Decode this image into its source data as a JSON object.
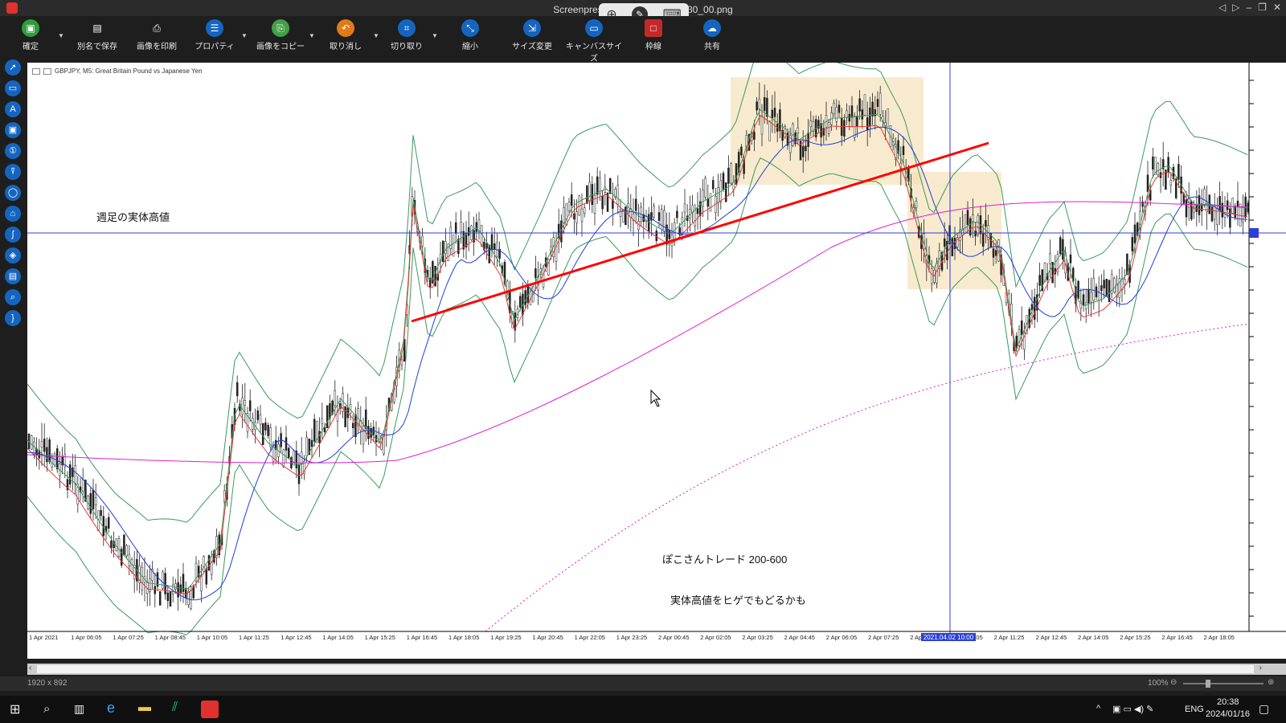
{
  "window": {
    "title": "Screenpressoの画像 ... 16_20h30_00.png"
  },
  "toolbar": {
    "confirm": "確定",
    "save_as": "別名で保存",
    "print": "画像を印刷",
    "properties": "プロパティ",
    "copy": "画像をコピー",
    "undo": "取り消し",
    "crop": "切り取り",
    "shrink": "縮小",
    "resize": "サイズ変更",
    "canvas": "キャンバスサイズ",
    "border": "枠線",
    "share": "共有"
  },
  "chart": {
    "header": "GBPJPY, M5: Great Britain Pound vs Japanese Yen",
    "time_labels": [
      "1 Apr 2021",
      "1 Apr 06:05",
      "1 Apr 07:25",
      "1 Apr 08:45",
      "1 Apr 10:05",
      "1 Apr 11:25",
      "1 Apr 12:45",
      "1 Apr 14:05",
      "1 Apr 15:25",
      "1 Apr 16:45",
      "1 Apr 18:05",
      "1 Apr 19:25",
      "1 Apr 20:45",
      "1 Apr 22:05",
      "1 Apr 23:25",
      "2 Apr 00:45",
      "2 Apr 02:05",
      "2 Apr 03:25",
      "2 Apr 04:45",
      "2 Apr 06:05",
      "2 Apr 07:25",
      "2 Apr 08:45",
      "2 Apr 10:05",
      "2 Apr 11:25",
      "2 Apr 12:45",
      "2 Apr 14:05",
      "2 Apr 15:25",
      "2 Apr 16:45",
      "2 Apr 18:05"
    ],
    "crosshair_label": "2021.04.02 10:00",
    "annotation_weekly_high": "週足の実体高値",
    "annotation_trade": "ぽこさんトレード  200-600",
    "annotation_note": "実体高値をヒゲでもどるかも"
  },
  "statusbar": {
    "image_size": "1920 x 892",
    "zoom": "100%"
  },
  "taskbar": {
    "lang": "ENG",
    "time": "20:38",
    "date": "2024/01/16"
  },
  "colors": {
    "trendline": "#ff0000",
    "highlight": "#f5deb3",
    "ma_red": "#e53935",
    "ma_blue": "#1e3fd6",
    "ma_magenta": "#e01fd0",
    "bollinger": "#3a9a5a"
  }
}
